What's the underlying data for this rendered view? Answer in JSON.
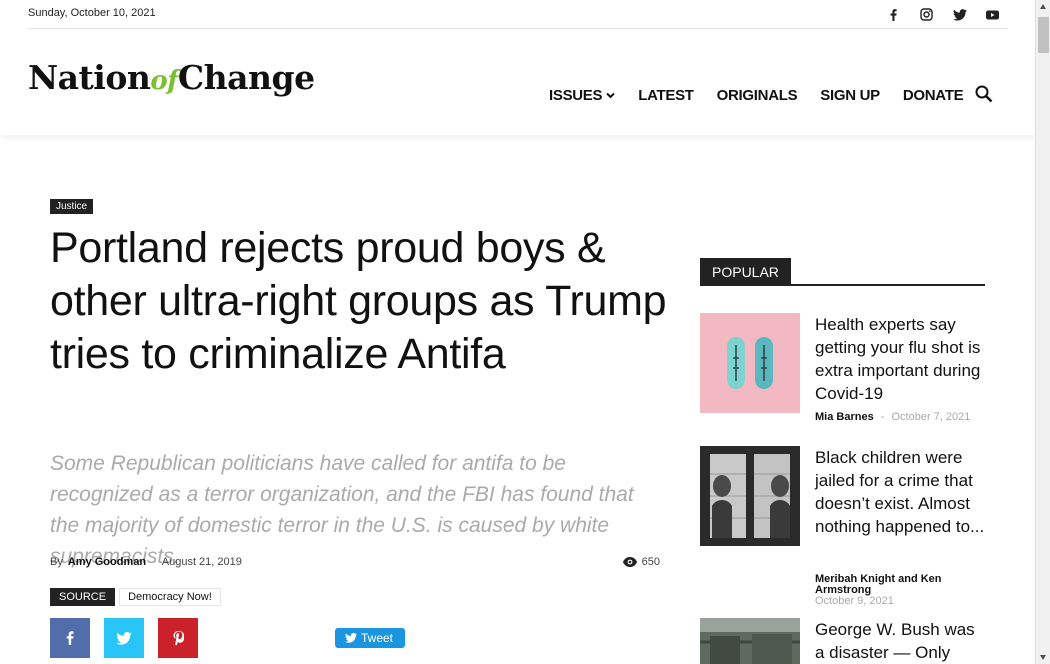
{
  "topbar": {
    "date": "Sunday, October 10, 2021",
    "social": [
      "facebook-icon",
      "instagram-icon",
      "twitter-icon",
      "youtube-icon"
    ]
  },
  "header": {
    "logo": {
      "part1": "Nation",
      "part2": "of",
      "part3": "Change"
    },
    "nav": [
      {
        "label": "ISSUES",
        "has_dropdown": true
      },
      {
        "label": "LATEST"
      },
      {
        "label": "ORIGINALS"
      },
      {
        "label": "SIGN UP"
      },
      {
        "label": "DONATE"
      }
    ]
  },
  "article": {
    "category": "Justice",
    "title": "Portland rejects proud boys & other ultra-right groups as Trump tries to criminalize Antifa",
    "subtitle": "Some Republican politicians have called for antifa to be recognized as a terror organization, and the FBI has found that the majority of domestic terror in the U.S. is caused by white supremacists.",
    "by": "By",
    "author": "Amy Goodman",
    "separator": "-",
    "date": "August 21, 2019",
    "views": "650",
    "source_label": "SOURCE",
    "source_value": "Democracy Now!",
    "tweet_label": "Tweet"
  },
  "sidebar": {
    "heading": "POPULAR",
    "items": [
      {
        "title": "Health experts say getting your flu shot is extra important during Covid-19",
        "author": "Mia Barnes",
        "separator": "-",
        "date": "October 7, 2021"
      },
      {
        "title": "Black children were jailed for a crime that doesn’t exist. Almost nothing happened to...",
        "author": "Meribah Knight and Ken Armstrong",
        "separator": "-",
        "date": "October 9, 2021"
      },
      {
        "title": "George W. Bush was a disaster — Only"
      }
    ]
  },
  "colors": {
    "logo_accent": "#7bbf32",
    "facebook": "#516eab",
    "twitter": "#29c5f6",
    "pinterest": "#ca212a",
    "tweet_button": "#1b95e0"
  }
}
